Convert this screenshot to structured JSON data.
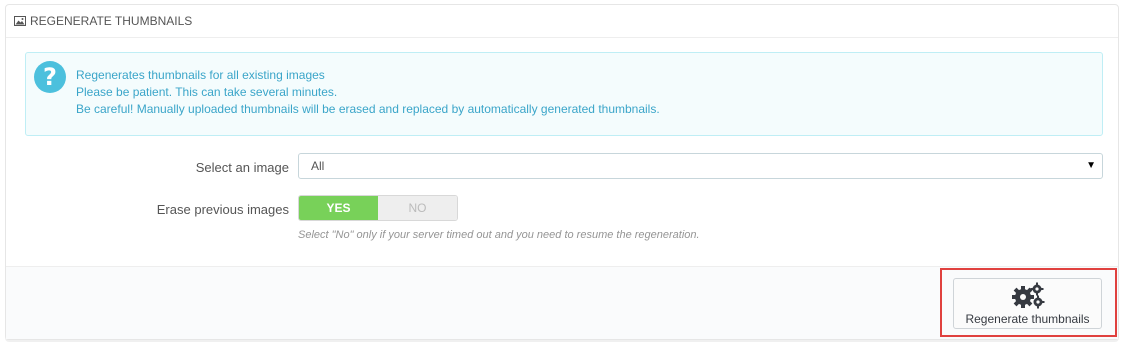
{
  "panel": {
    "title": "REGENERATE THUMBNAILS"
  },
  "alert": {
    "lines": [
      "Regenerates thumbnails for all existing images",
      "Please be patient. This can take several minutes.",
      "Be careful! Manually uploaded thumbnails will be erased and replaced by automatically generated thumbnails."
    ],
    "icon": "question-icon"
  },
  "form": {
    "select_label": "Select an image",
    "select_value": "All",
    "erase_label": "Erase previous images",
    "switch_yes": "YES",
    "switch_no": "NO",
    "switch_selected": "YES",
    "help_text": "Select \"No\" only if your server timed out and you need to resume the regeneration."
  },
  "footer": {
    "button_label": "Regenerate thumbnails",
    "button_icon": "gears-icon"
  },
  "colors": {
    "accent_green": "#78d159",
    "info_text": "#3aa5c9",
    "highlight_red": "#e0413f"
  }
}
